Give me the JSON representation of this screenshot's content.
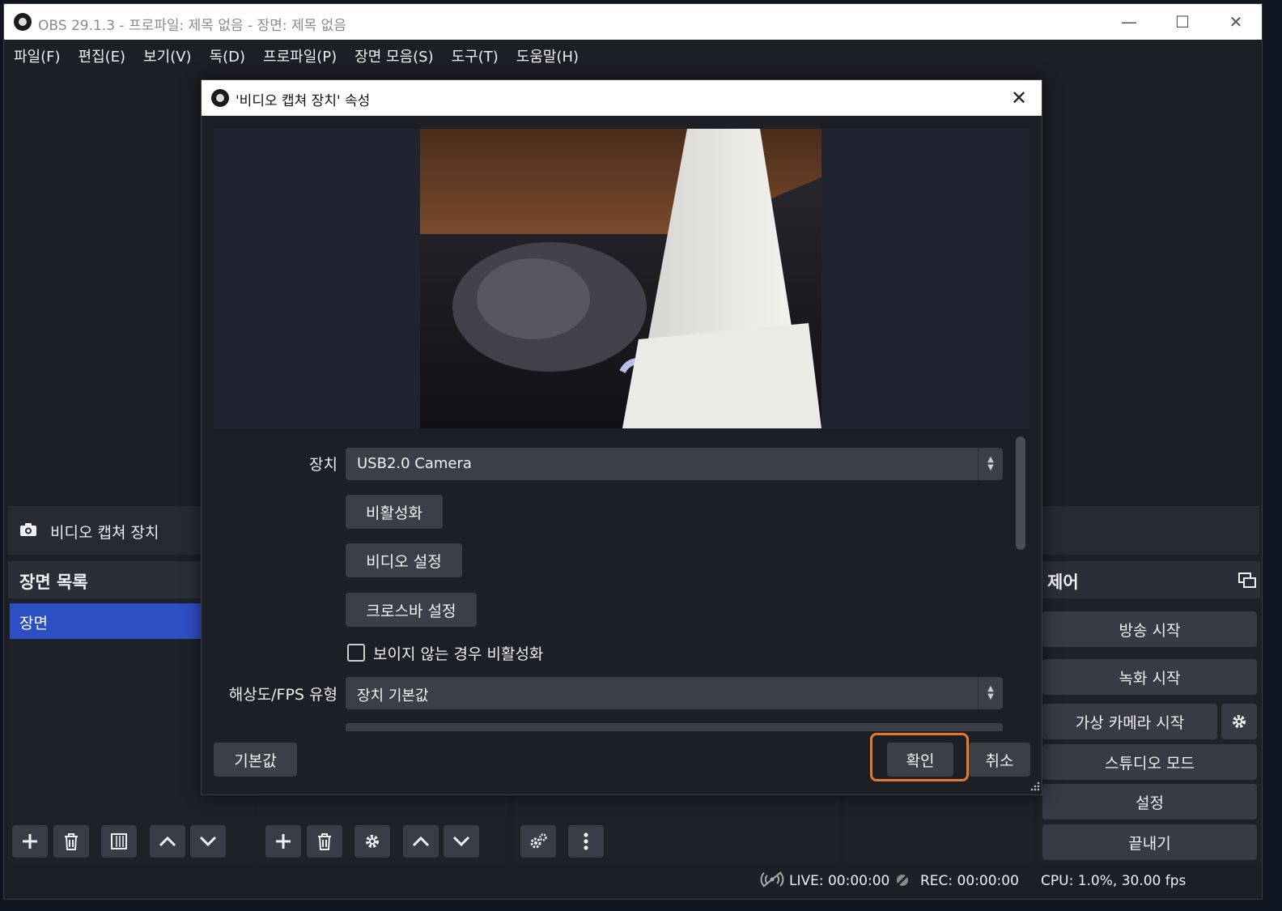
{
  "window": {
    "title": "OBS 29.1.3 - 프로파일: 제목 없음 - 장면: 제목 없음",
    "minimize": "—",
    "maximize": "☐",
    "close": "✕"
  },
  "menu": [
    "파일(F)",
    "편집(E)",
    "보기(V)",
    "독(D)",
    "프로파일(P)",
    "장면 모음(S)",
    "도구(T)",
    "도움말(H)"
  ],
  "source_bar": {
    "label": "비디오 캡쳐 장치"
  },
  "scenes": {
    "title": "장면 목록",
    "items": [
      "장면"
    ]
  },
  "controls": {
    "title": "제어",
    "buttons": [
      "방송 시작",
      "녹화 시작",
      "가상 카메라 시작",
      "스튜디오 모드",
      "설정",
      "끝내기"
    ]
  },
  "status": {
    "live": "LIVE: 00:00:00",
    "rec": "REC: 00:00:00",
    "cpu": "CPU: 1.0%, 30.00 fps"
  },
  "dialog": {
    "title": "'비디오 캡쳐 장치' 속성",
    "close": "✕",
    "device_label": "장치",
    "device_value": "USB2.0 Camera",
    "deactivate_button": "비활성화",
    "video_settings_button": "비디오 설정",
    "crossbar_settings_button": "크로스바 설정",
    "deactivate_when_hidden_label": "보이지 않는 경우 비활성화",
    "resolution_type_label": "해상도/FPS 유형",
    "resolution_type_value": "장치 기본값",
    "defaults_button": "기본값",
    "ok_button": "확인",
    "cancel_button": "취소"
  },
  "colors": {
    "accent": "#2d4fc4",
    "highlight": "#e7782a",
    "panel": "#272a33",
    "background": "#1d1f26"
  }
}
